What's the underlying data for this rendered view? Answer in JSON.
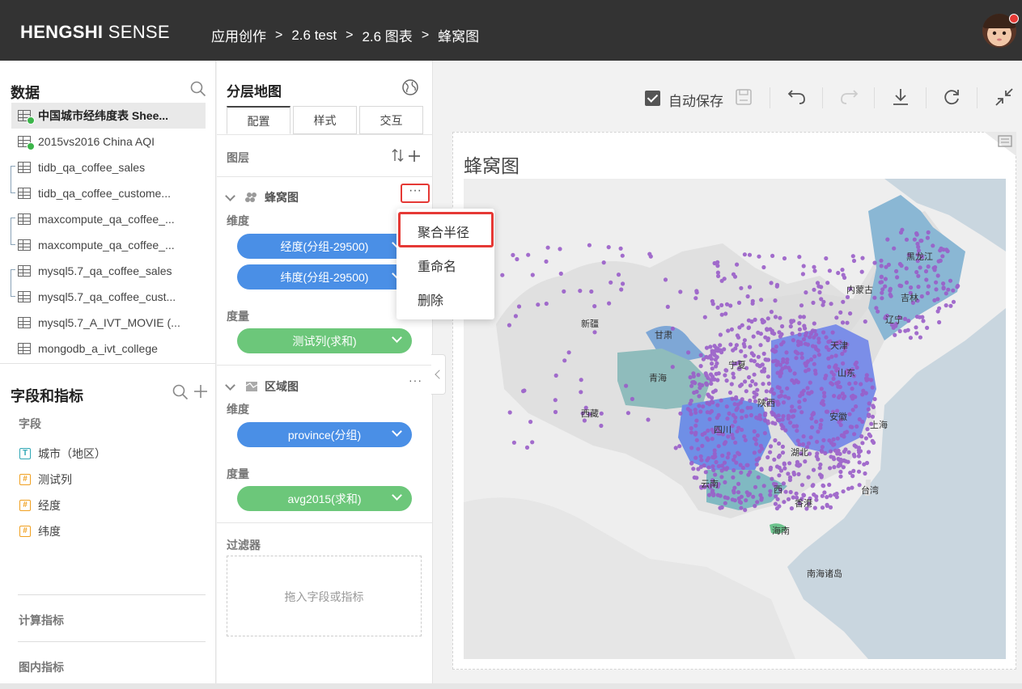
{
  "header": {
    "brand_bold": "HENGSHI",
    "brand_light": "SENSE",
    "breadcrumb": [
      "应用创作",
      "2.6 test",
      "2.6 图表",
      "蜂窝图"
    ]
  },
  "left_panel": {
    "data_title": "数据",
    "datasets": [
      {
        "label": "中国城市经纬度表 Shee...",
        "active": true,
        "badge": true
      },
      {
        "label": "2015vs2016 China AQI",
        "badge": true
      },
      {
        "label": "tidb_qa_coffee_sales"
      },
      {
        "label": "tidb_qa_coffee_custome..."
      },
      {
        "label": "maxcompute_qa_coffee_..."
      },
      {
        "label": "maxcompute_qa_coffee_..."
      },
      {
        "label": "mysql5.7_qa_coffee_sales"
      },
      {
        "label": "mysql5.7_qa_coffee_cust..."
      },
      {
        "label": "mysql5.7_A_IVT_MOVIE (..."
      },
      {
        "label": "mongodb_a_ivt_college"
      }
    ],
    "fields_title": "字段和指标",
    "fields_label": "字段",
    "fields": [
      {
        "type": "T",
        "label": "城市（地区）"
      },
      {
        "type": "#",
        "label": "测试列"
      },
      {
        "type": "#",
        "label": "经度"
      },
      {
        "type": "#",
        "label": "纬度"
      }
    ],
    "calc_metrics": "计算指标",
    "chart_metrics": "图内指标"
  },
  "config_panel": {
    "title": "分层地图",
    "tabs": [
      "配置",
      "样式",
      "交互"
    ],
    "layers_label": "图层",
    "layer1": {
      "name": "蜂窝图",
      "dims_label": "维度",
      "dims": [
        "经度(分组-29500)",
        "纬度(分组-29500)"
      ],
      "measures_label": "度量",
      "measures": [
        "测试列(求和)"
      ],
      "more": "···"
    },
    "layer2": {
      "name": "区域图",
      "dims_label": "维度",
      "dims": [
        "province(分组)"
      ],
      "measures_label": "度量",
      "measures": [
        "avg2015(求和)"
      ],
      "more": "···"
    },
    "filter_label": "过滤器",
    "filter_placeholder": "拖入字段或指标"
  },
  "context_menu": {
    "items": [
      "聚合半径",
      "重命名",
      "删除"
    ]
  },
  "toolbar": {
    "autosave_label": "自动保存"
  },
  "chart": {
    "title": "蜂窝图",
    "map_labels": [
      {
        "label": "黑龙江"
      },
      {
        "label": "内蒙古"
      },
      {
        "label": "吉林"
      },
      {
        "label": "辽宁"
      },
      {
        "label": "新疆"
      },
      {
        "label": "甘肃"
      },
      {
        "label": "天津"
      },
      {
        "label": "宁夏"
      },
      {
        "label": "山东"
      },
      {
        "label": "青海"
      },
      {
        "label": "陕西"
      },
      {
        "label": "安徽"
      },
      {
        "label": "西藏"
      },
      {
        "label": "四川"
      },
      {
        "label": "上海"
      },
      {
        "label": "湖北"
      },
      {
        "label": "云南"
      },
      {
        "label": "西"
      },
      {
        "label": "香港"
      },
      {
        "label": "台湾"
      },
      {
        "label": "海南"
      },
      {
        "label": "南海诸岛"
      }
    ]
  }
}
